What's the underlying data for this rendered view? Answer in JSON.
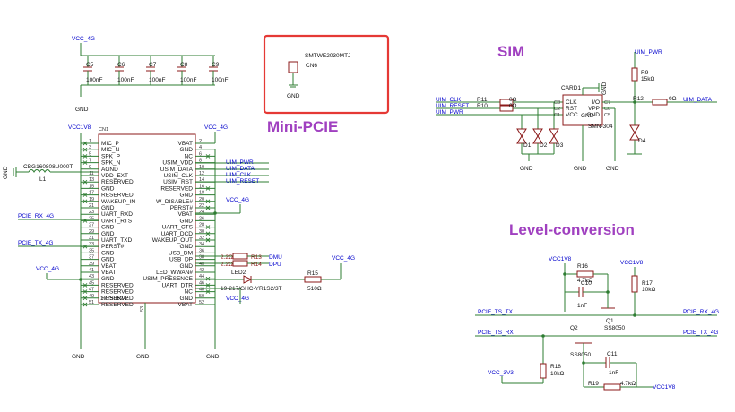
{
  "colors": {
    "wire": "#2e7d32",
    "body": "#8b1a1a",
    "net": "#0000cc",
    "heading": "#a040c0",
    "highlight": "#e53935"
  },
  "headings": {
    "mini_pcie": "Mini-PCIE",
    "sim": "SIM",
    "level": "Level-conversion"
  },
  "decoupling": {
    "net": "VCC_4G",
    "gnd": "GND",
    "caps": [
      {
        "ref": "C5",
        "val": "100nF"
      },
      {
        "ref": "C6",
        "val": "100nF"
      },
      {
        "ref": "C7",
        "val": "100nF"
      },
      {
        "ref": "C8",
        "val": "100nF"
      },
      {
        "ref": "C9",
        "val": "100nF"
      }
    ]
  },
  "cn6": {
    "part": "SMTWE2030MTJ",
    "ref": "CN6",
    "gnd": "GND"
  },
  "pcie": {
    "ref": "CN1",
    "part": "1775862-2",
    "pin53": "53",
    "power_net": "VCC1V8",
    "vcc": "VCC_4G",
    "gnd": "GND",
    "left_pins": [
      {
        "n": "1",
        "name": "MIC_P"
      },
      {
        "n": "3",
        "name": "MIC_N"
      },
      {
        "n": "5",
        "name": "SPK_P"
      },
      {
        "n": "7",
        "name": "SPK_N"
      },
      {
        "n": "9",
        "name": "AGND"
      },
      {
        "n": "11",
        "name": "VDD_EXT"
      },
      {
        "n": "13",
        "name": "RESERVED"
      },
      {
        "n": "15",
        "name": "GND"
      },
      {
        "n": "17",
        "name": "RESERVED"
      },
      {
        "n": "19",
        "name": "WAKEUP_IN"
      },
      {
        "n": "21",
        "name": "GND"
      },
      {
        "n": "23",
        "name": "UART_RXD"
      },
      {
        "n": "25",
        "name": "UART_RTS"
      },
      {
        "n": "27",
        "name": "GND"
      },
      {
        "n": "29",
        "name": "GND"
      },
      {
        "n": "31",
        "name": "UART_TXD"
      },
      {
        "n": "33",
        "name": "PERST#"
      },
      {
        "n": "35",
        "name": "GND"
      },
      {
        "n": "37",
        "name": "GND"
      },
      {
        "n": "39",
        "name": "VBAT"
      },
      {
        "n": "41",
        "name": "VBAT"
      },
      {
        "n": "43",
        "name": "GND"
      },
      {
        "n": "45",
        "name": "RESERVED"
      },
      {
        "n": "47",
        "name": "RESERVED"
      },
      {
        "n": "49",
        "name": "RESERVED"
      },
      {
        "n": "51",
        "name": "RESERVED"
      }
    ],
    "right_pins": [
      {
        "n": "2",
        "name": "VBAT"
      },
      {
        "n": "4",
        "name": "GND"
      },
      {
        "n": "6",
        "name": "NC"
      },
      {
        "n": "8",
        "name": "USIM_VDD"
      },
      {
        "n": "10",
        "name": "USIM_DATA"
      },
      {
        "n": "12",
        "name": "USIM_CLK"
      },
      {
        "n": "14",
        "name": "USIM_RST"
      },
      {
        "n": "16",
        "name": "RESERVED"
      },
      {
        "n": "18",
        "name": "GND"
      },
      {
        "n": "20",
        "name": "W_DISABLE#"
      },
      {
        "n": "22",
        "name": "PERST#"
      },
      {
        "n": "24",
        "name": "VBAT"
      },
      {
        "n": "26",
        "name": "GND"
      },
      {
        "n": "28",
        "name": "UART_CTS"
      },
      {
        "n": "30",
        "name": "UART_DCD"
      },
      {
        "n": "32",
        "name": "WAKEUP_OUT"
      },
      {
        "n": "34",
        "name": "GND"
      },
      {
        "n": "36",
        "name": "USB_DM"
      },
      {
        "n": "38",
        "name": "USB_DP"
      },
      {
        "n": "40",
        "name": "GND"
      },
      {
        "n": "42",
        "name": "LED_WWAN#"
      },
      {
        "n": "44",
        "name": "USIM_PRESENCE"
      },
      {
        "n": "46",
        "name": "UART_DTR"
      },
      {
        "n": "48",
        "name": "NC"
      },
      {
        "n": "50",
        "name": "GND"
      },
      {
        "n": "52",
        "name": "VBAT"
      }
    ],
    "sim_nets": [
      "UIM_PWR",
      "UIM_DATA",
      "UIM_CLK",
      "UIM_RESET"
    ],
    "left_nets": {
      "rx": "PCIE_RX_4G",
      "tx": "PCIE_TX_4G"
    },
    "inductor": {
      "part": "CBG160808U000T",
      "ref": "L1"
    },
    "usb": {
      "r13": "R13",
      "r14": "R14",
      "val": "2.2Ω",
      "dm": "DMU",
      "dp": "DPU"
    },
    "led": {
      "ref": "LED2",
      "part": "19-217/GHC-YR1S2/3T",
      "r": "R15",
      "rval": "510Ω",
      "net": "VCC_4G"
    }
  },
  "sim": {
    "ref": "CARD1",
    "part": "SMN-304",
    "left_nets": [
      "UIM_CLK",
      "UIM_RESET",
      "UIM_PWR"
    ],
    "res": [
      {
        "ref": "R11",
        "val": "0Ω"
      },
      {
        "ref": "R10",
        "val": "0Ω"
      }
    ],
    "pins_left": [
      {
        "n": "C3",
        "name": "CLK"
      },
      {
        "n": "C2",
        "name": "RST"
      },
      {
        "n": "C1",
        "name": "VCC"
      }
    ],
    "pins_right": [
      {
        "n": "C7",
        "name": "I/O"
      },
      {
        "n": "C6",
        "name": "VPP"
      },
      {
        "n": "C5",
        "name": "GND"
      }
    ],
    "gnd_pin": "GND",
    "diodes": [
      "D1",
      "D2",
      "D3",
      "D4"
    ],
    "r9": {
      "ref": "R9",
      "val": "15kΩ"
    },
    "r12": {
      "ref": "R12",
      "val": "0Ω"
    },
    "pwr": "UIM_PWR",
    "data": "UIM_DATA",
    "gnd": "GND"
  },
  "level": {
    "vcc1v8": "VCC1V8",
    "vcc3v3": "VCC_3V3",
    "r16": {
      "ref": "R16",
      "val": "4.7kΩ"
    },
    "c10": {
      "ref": "C10",
      "val": "1nF"
    },
    "r17": {
      "ref": "R17",
      "val": "10kΩ"
    },
    "q1": {
      "ref": "Q1",
      "part": "SS8050"
    },
    "q2": {
      "ref": "Q2",
      "part": "SS8050"
    },
    "r18": {
      "ref": "R18",
      "val": "10kΩ"
    },
    "c11": {
      "ref": "C11",
      "val": "1nF"
    },
    "r19": {
      "ref": "R19",
      "val": "4.7kΩ"
    },
    "nets": {
      "ts_tx": "PCIE_TS_TX",
      "rx4g": "PCIE_RX_4G",
      "ts_rx": "PCIE_TS_RX",
      "tx4g": "PCIE_TX_4G"
    }
  }
}
